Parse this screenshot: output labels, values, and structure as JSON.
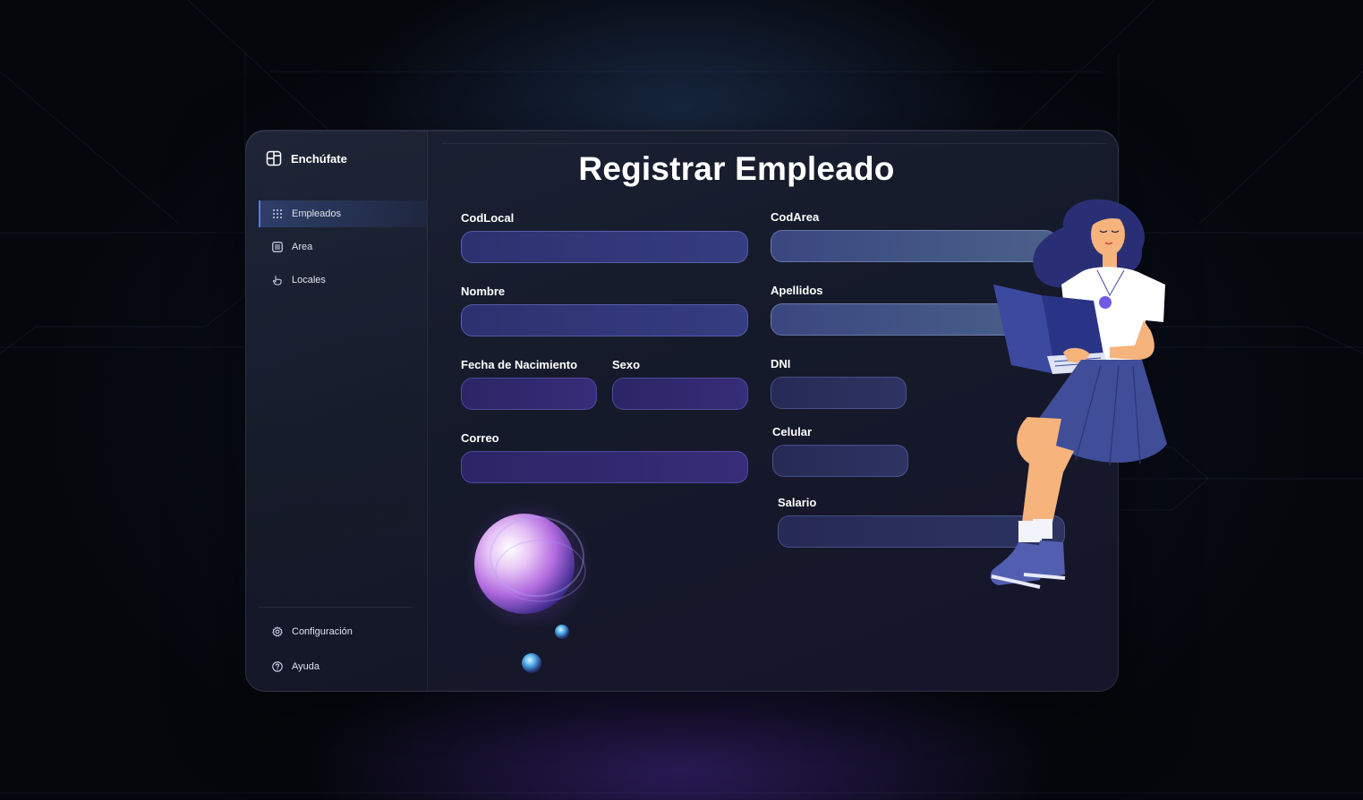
{
  "app": {
    "name": "Enchúfate",
    "brand_icon": "layout-grid-icon"
  },
  "sidebar": {
    "items": [
      {
        "label": "Empleados",
        "icon": "grid-dots-icon",
        "active": true
      },
      {
        "label": "Area",
        "icon": "list-icon",
        "active": false
      },
      {
        "label": "Locales",
        "icon": "hand-pointer-icon",
        "active": false
      }
    ],
    "bottom_items": [
      {
        "label": "Configuración",
        "icon": "gear-icon"
      },
      {
        "label": "Ayuda",
        "icon": "help-circle-icon"
      }
    ]
  },
  "form": {
    "title": "Registrar Empleado",
    "fields": {
      "codlocal": {
        "label": "CodLocal",
        "value": ""
      },
      "codarea": {
        "label": "CodArea",
        "value": ""
      },
      "nombre": {
        "label": "Nombre",
        "value": ""
      },
      "apellidos": {
        "label": "Apellidos",
        "value": ""
      },
      "fecha_nacimiento": {
        "label": "Fecha de Nacimiento",
        "value": ""
      },
      "sexo": {
        "label": "Sexo",
        "value": ""
      },
      "dni": {
        "label": "DNI",
        "value": ""
      },
      "correo": {
        "label": "Correo",
        "value": ""
      },
      "celular": {
        "label": "Celular",
        "value": ""
      },
      "salario": {
        "label": "Salario",
        "value": ""
      }
    }
  },
  "colors": {
    "accent": "#5a7bd8",
    "background": "#05070c",
    "window": "#171c2c"
  }
}
